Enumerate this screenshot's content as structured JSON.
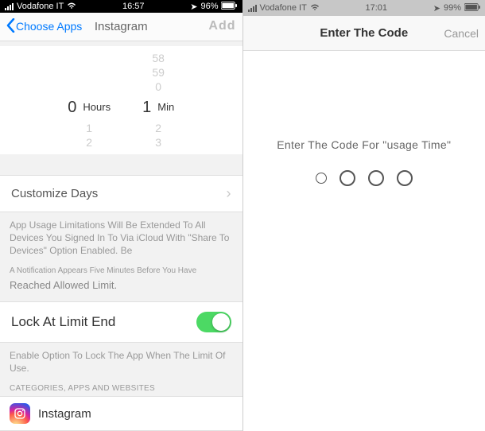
{
  "left": {
    "status": {
      "carrier": "Vodafone IT",
      "time": "16:57",
      "battery": "96%"
    },
    "nav": {
      "back": "Choose Apps",
      "title": "Instagram",
      "action": "Add"
    },
    "picker": {
      "hours": {
        "selected": "0",
        "below": [
          "1",
          "2"
        ],
        "unit": "Hours"
      },
      "minutes": {
        "above": [
          "58",
          "59",
          "0"
        ],
        "selected": "1",
        "below": [
          "2",
          "3"
        ],
        "unit": "Min"
      }
    },
    "customize_days": "Customize Days",
    "limit_note1": "App Usage Limitations Will Be Extended To All Devices You Signed In To Via iCloud With \"Share To Devices\" Option Enabled. Be",
    "limit_note2": "A Notification Appears Five Minutes Before You Have",
    "limit_note3": "Reached Allowed Limit.",
    "lock_row": "Lock At Limit End",
    "lock_note": "Enable Option To Lock The App When The Limit Of Use.",
    "section_header": "CATEGORIES, APPS AND WEBSITES",
    "app_name": "Instagram"
  },
  "right": {
    "status": {
      "carrier": "Vodafone IT",
      "time": "17:01",
      "battery": "99%"
    },
    "nav": {
      "title": "Enter The Code",
      "cancel": "Cancel"
    },
    "prompt": "Enter The Code For \"usage Time\""
  }
}
